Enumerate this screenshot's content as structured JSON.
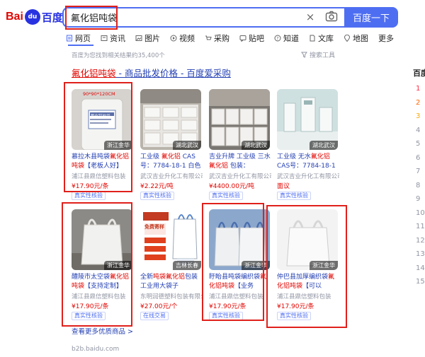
{
  "header": {
    "logo_bai": "Bai",
    "logo_du": "百度",
    "logo_paw": "du",
    "search_value": "氟化铝吨袋",
    "search_button": "百度一下",
    "clear_icon": "×"
  },
  "tabs": [
    {
      "label": "网页",
      "icon": "paper-icon"
    },
    {
      "label": "资讯",
      "icon": "news-icon"
    },
    {
      "label": "图片",
      "icon": "image-icon"
    },
    {
      "label": "视频",
      "icon": "video-icon"
    },
    {
      "label": "采购",
      "icon": "cart-icon"
    },
    {
      "label": "贴吧",
      "icon": "tieba-icon"
    },
    {
      "label": "知道",
      "icon": "question-icon"
    },
    {
      "label": "文库",
      "icon": "doc-icon"
    },
    {
      "label": "地图",
      "icon": "pin-icon"
    },
    {
      "label": "更多",
      "icon": ""
    }
  ],
  "result_count_text": "百度为您找到相关结果约35,400个",
  "search_tools": "搜索工具",
  "result": {
    "title_highlight": "氟化铝吨袋",
    "title_rest": " - 商品批发价格 - 百度爱采购",
    "more_link": "查看更多优质商品 >",
    "source": "b2b.baidu.com"
  },
  "products": [
    {
      "location": "浙江金华",
      "title_pre": "慕拉木县吨袋",
      "title_red": "氟化铝吨袋",
      "title_post": "【老板人好】",
      "company": "浦江县鼎信塑料包装",
      "price": "¥17.90元/条",
      "badge": "真实性核验",
      "img_caption": "90*90*120CM",
      "img_label": "氟化铝吨袋"
    },
    {
      "location": "湖北武汉",
      "title_pre": "工业级 ",
      "title_red": "氟化铝",
      "title_post": " CAS号：7784-18-1 白色",
      "company": "武汉吉业升化工有限公司",
      "price": "¥2.22元/吨",
      "badge": "真实性核验"
    },
    {
      "location": "湖北武汉",
      "title_pre": "吉业升牌 工业级 三水",
      "title_red": "氟化铝",
      "title_post": " 包装：",
      "company": "武汉吉业升化工有限公司",
      "price": "¥4400.00元/吨",
      "badge": "真实性核验"
    },
    {
      "location": "湖北武汉",
      "title_pre": "工业级 无水",
      "title_red": "氟化铝",
      "title_post": " CAS号：7784-18-1",
      "company": "武汉吉业升化工有限公司",
      "price": "面议",
      "badge": "真实性核验"
    },
    {
      "location": "浙江金华",
      "title_pre": "醴陵市太空袋",
      "title_red": "氟化铝吨袋",
      "title_post": "【支持定制】",
      "company": "浦江县鼎信塑料包装",
      "price": "¥17.90元/条",
      "badge": "真实性核验"
    },
    {
      "location": "吉林长春",
      "title_pre": "全新",
      "title_red": "吨袋氟化铝",
      "title_post": "包装工业用大袋子",
      "company": "东明润德塑料包装有限公司",
      "price": "¥27.00元/个",
      "badge": "在线交易",
      "img_label": "免费寄样"
    },
    {
      "location": "浙江金华",
      "title_pre": "盱眙县吨袋编织袋",
      "title_red": "氟化铝吨袋",
      "title_post": "【业务",
      "company": "浦江县鼎信塑料包装",
      "price": "¥17.90元/条",
      "badge": "真实性核验"
    },
    {
      "location": "浙江金华",
      "title_pre": "仲巴县加厚编织袋",
      "title_red": "氟化铝吨袋",
      "title_post": "【可以",
      "company": "浦江县鼎信塑料包装",
      "price": "¥17.90元/条",
      "badge": "真实性核验"
    }
  ],
  "right_panel": {
    "title": "百度",
    "numbers": [
      "1",
      "2",
      "3",
      "4",
      "5",
      "6",
      "7",
      "8",
      "9",
      "10",
      "11",
      "12",
      "13",
      "14",
      "15"
    ]
  },
  "colors": {
    "accent": "#4e6ef2",
    "link": "#2440b3",
    "red": "#e10602",
    "annotation": "#e0201b"
  }
}
